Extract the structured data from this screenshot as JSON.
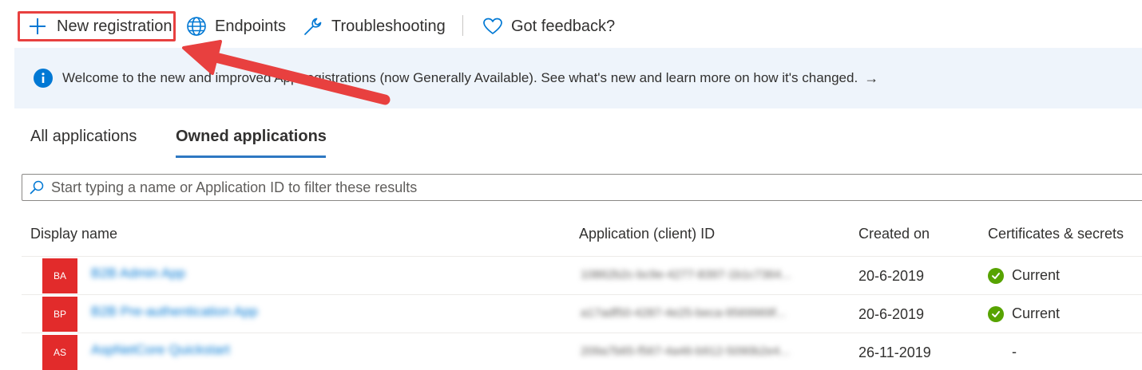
{
  "toolbar": {
    "new_registration_label": "New registration",
    "endpoints_label": "Endpoints",
    "troubleshooting_label": "Troubleshooting",
    "feedback_label": "Got feedback?"
  },
  "banner": {
    "text": "Welcome to the new and improved App registrations (now Generally Available). See what's new and learn more on how it's changed.",
    "arrow": "→"
  },
  "tabs": [
    {
      "label": "All applications",
      "selected": false
    },
    {
      "label": "Owned applications",
      "selected": true
    }
  ],
  "search": {
    "placeholder": "Start typing a name or Application ID to filter these results"
  },
  "table": {
    "columns": [
      "Display name",
      "Application (client) ID",
      "Created on",
      "Certificates & secrets"
    ],
    "rows": [
      {
        "initials": "BA",
        "name": "B2B Admin App",
        "client_id": "10862b2c-bc9e-4277-8397-1b1c7364...",
        "created": "20-6-2019",
        "certs": "Current"
      },
      {
        "initials": "BP",
        "name": "B2B Pre-authentication App",
        "client_id": "a17adf50-4287-4e25-beca-9569969f...",
        "created": "20-6-2019",
        "certs": "Current"
      },
      {
        "initials": "AS",
        "name": "AspNetCore Quickstart",
        "client_id": "209a7b65-f567-4a46-b912-5090b2e4...",
        "created": "26-11-2019",
        "certs": "-"
      }
    ]
  },
  "colors": {
    "accent": "#0078d4",
    "highlight": "#e8403f",
    "avatar": "#e22b2b",
    "status_ok": "#57a300",
    "banner_bg": "#eef4fb"
  }
}
